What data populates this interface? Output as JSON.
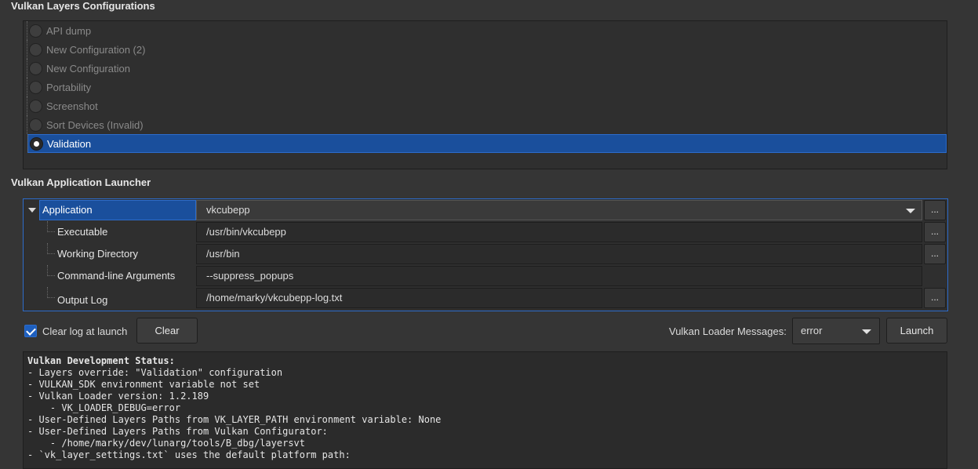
{
  "configurations": {
    "title": "Vulkan Layers Configurations",
    "items": [
      {
        "label": "API dump",
        "selected": false
      },
      {
        "label": "New Configuration (2)",
        "selected": false
      },
      {
        "label": "New Configuration",
        "selected": false
      },
      {
        "label": "Portability",
        "selected": false
      },
      {
        "label": "Screenshot",
        "selected": false
      },
      {
        "label": "Sort Devices (Invalid)",
        "selected": false
      },
      {
        "label": "Validation",
        "selected": true
      }
    ]
  },
  "launcher": {
    "title": "Vulkan Application Launcher",
    "application_label": "Application",
    "application_value": "vkcubepp",
    "executable_label": "Executable",
    "executable_value": "/usr/bin/vkcubepp",
    "working_dir_label": "Working Directory",
    "working_dir_value": "/usr/bin",
    "args_label": "Command-line Arguments",
    "args_value": "--suppress_popups",
    "log_label": "Output Log",
    "log_value": "/home/marky/vkcubepp-log.txt",
    "browse_label": "..."
  },
  "controls": {
    "clear_log_label": "Clear log at launch",
    "clear_log_checked": true,
    "clear_button": "Clear",
    "loader_messages_label": "Vulkan Loader Messages:",
    "loader_messages_value": "error",
    "launch_button": "Launch"
  },
  "status": {
    "title": "Vulkan Development Status:",
    "lines": [
      "- Layers override: \"Validation\" configuration",
      "- VULKAN_SDK environment variable not set",
      "- Vulkan Loader version: 1.2.189",
      "    - VK_LOADER_DEBUG=error",
      "- User-Defined Layers Paths from VK_LAYER_PATH environment variable: None",
      "- User-Defined Layers Paths from Vulkan Configurator:",
      "    - /home/marky/dev/lunarg/tools/B_dbg/layersvt",
      "- `vk_layer_settings.txt` uses the default platform path:"
    ]
  }
}
